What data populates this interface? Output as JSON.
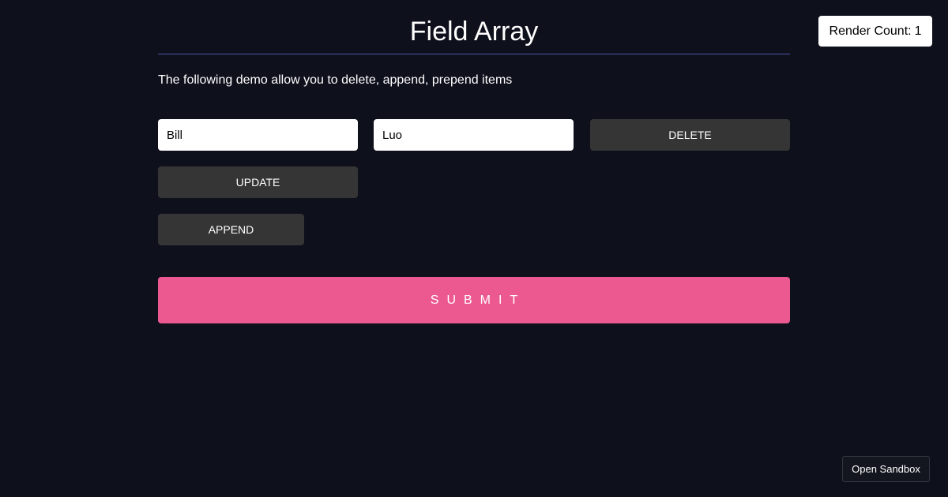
{
  "header": {
    "title": "Field Array",
    "description": "The following demo allow you to delete, append, prepend items"
  },
  "render_count": {
    "label": "Render Count:",
    "value": "1"
  },
  "field_array": {
    "items": [
      {
        "first_name": "Bill",
        "last_name": "Luo",
        "delete_label": "DELETE"
      }
    ],
    "update_label": "UPDATE",
    "append_label": "APPEND"
  },
  "submit_label": "SUBMIT",
  "sandbox_label": "Open Sandbox",
  "colors": {
    "background": "#0e101c",
    "submit": "#ec5990",
    "button": "#353535",
    "divider": "#4f55a8"
  }
}
